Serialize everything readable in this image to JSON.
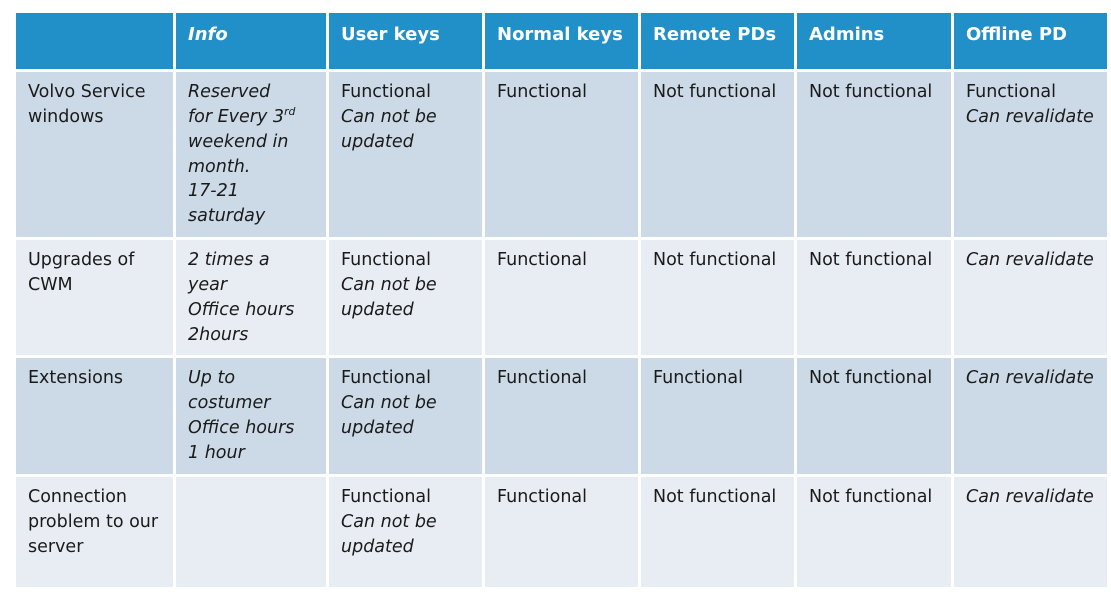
{
  "table": {
    "columns": [
      {
        "label": "",
        "style": "blank"
      },
      {
        "label": "Info",
        "style": "italic"
      },
      {
        "label": "User keys",
        "style": "normal"
      },
      {
        "label": "Normal keys",
        "style": "normal"
      },
      {
        "label": "Remote PDs",
        "style": "normal"
      },
      {
        "label": "Admins",
        "style": "normal"
      },
      {
        "label": "Offline PD",
        "style": "dimmed"
      }
    ],
    "header_bg": "#2290c8",
    "header_text": "#ffffff",
    "header_dim_text": "#9a9a9a",
    "row_band_a": "#ccd9e6",
    "row_band_b": "#e8edf4",
    "offline_text": "#a9a9a9",
    "rows": [
      {
        "topic": "Volvo Service windows",
        "info_lines": [
          "Reserved",
          "for Every 3",
          "weekend in",
          "month.",
          "17-21",
          "saturday"
        ],
        "info_ordinal": "rd",
        "user_keys_primary": "Functional",
        "user_keys_note": "Can not be updated",
        "normal_keys": "Functional",
        "remote_pds": "Not functional",
        "admins": "Not functional",
        "offline_pd_primary": "Functional",
        "offline_pd_note": "Can revalidate"
      },
      {
        "topic": "Upgrades of CWM",
        "info_lines": [
          "2 times a",
          "year",
          "Office hours",
          "2hours"
        ],
        "info_ordinal": "",
        "user_keys_primary": "Functional",
        "user_keys_note": "Can not be updated",
        "normal_keys": "Functional",
        "remote_pds": "Not functional",
        "admins": "Not functional",
        "offline_pd_primary": "",
        "offline_pd_note": "Can revalidate"
      },
      {
        "topic": "Extensions",
        "info_lines": [
          "Up to",
          "costumer",
          "Office hours",
          "1 hour"
        ],
        "info_ordinal": "",
        "user_keys_primary": "Functional",
        "user_keys_note": "Can not be updated",
        "normal_keys": "Functional",
        "remote_pds": "Functional",
        "admins": "Not functional",
        "offline_pd_primary": "",
        "offline_pd_note": "Can revalidate"
      },
      {
        "topic": "Connection problem to our server",
        "info_lines": [],
        "info_ordinal": "",
        "user_keys_primary": "Functional",
        "user_keys_note": "Can not be updated",
        "normal_keys": "Functional",
        "remote_pds": "Not functional",
        "admins": "Not functional",
        "offline_pd_primary": "",
        "offline_pd_note": "Can revalidate"
      }
    ]
  }
}
